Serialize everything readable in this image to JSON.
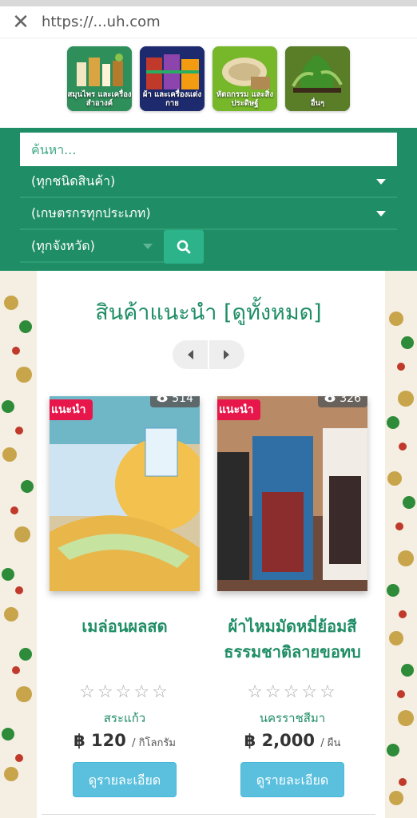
{
  "browser": {
    "url": "https://...uh.com"
  },
  "categories": [
    {
      "label": "สมุนไพร และเครื่องสำอางค์"
    },
    {
      "label": "ผ้า และเครื่องแต่งกาย"
    },
    {
      "label": "หัตถกรรม และสิ่งประดิษฐ์"
    },
    {
      "label": "อื่นๆ"
    }
  ],
  "search": {
    "placeholder": "ค้นหา...",
    "product_type": "(ทุกชนิดสินค้า)",
    "farmer_type": "(เกษตรกรทุกประเภท)",
    "province": "(ทุกจังหวัด)"
  },
  "recommended": {
    "title": "สินค้าแนะนำ [ดูทั้งหมด]"
  },
  "products": [
    {
      "badge": "แนะนำ",
      "views": "514",
      "name": "เมล่อนผลสด",
      "stars": "☆☆☆☆☆",
      "province": "สระแก้ว",
      "price": "฿ 120",
      "unit": "/ กิโลกรัม",
      "button": "ดูรายละเอียด"
    },
    {
      "badge": "แนะนำ",
      "views": "326",
      "name": "ผ้าไหมมัดหมี่ย้อมสีธรรมชาติลายขอทบ",
      "stars": "☆☆☆☆☆",
      "province": "นครราชสีมา",
      "price": "฿ 2,000",
      "unit": "/ ผืน",
      "button": "ดูรายละเอียด"
    }
  ],
  "colors": {
    "brand": "#1f8d66",
    "badge": "#e8174b",
    "button": "#5bc0de"
  }
}
